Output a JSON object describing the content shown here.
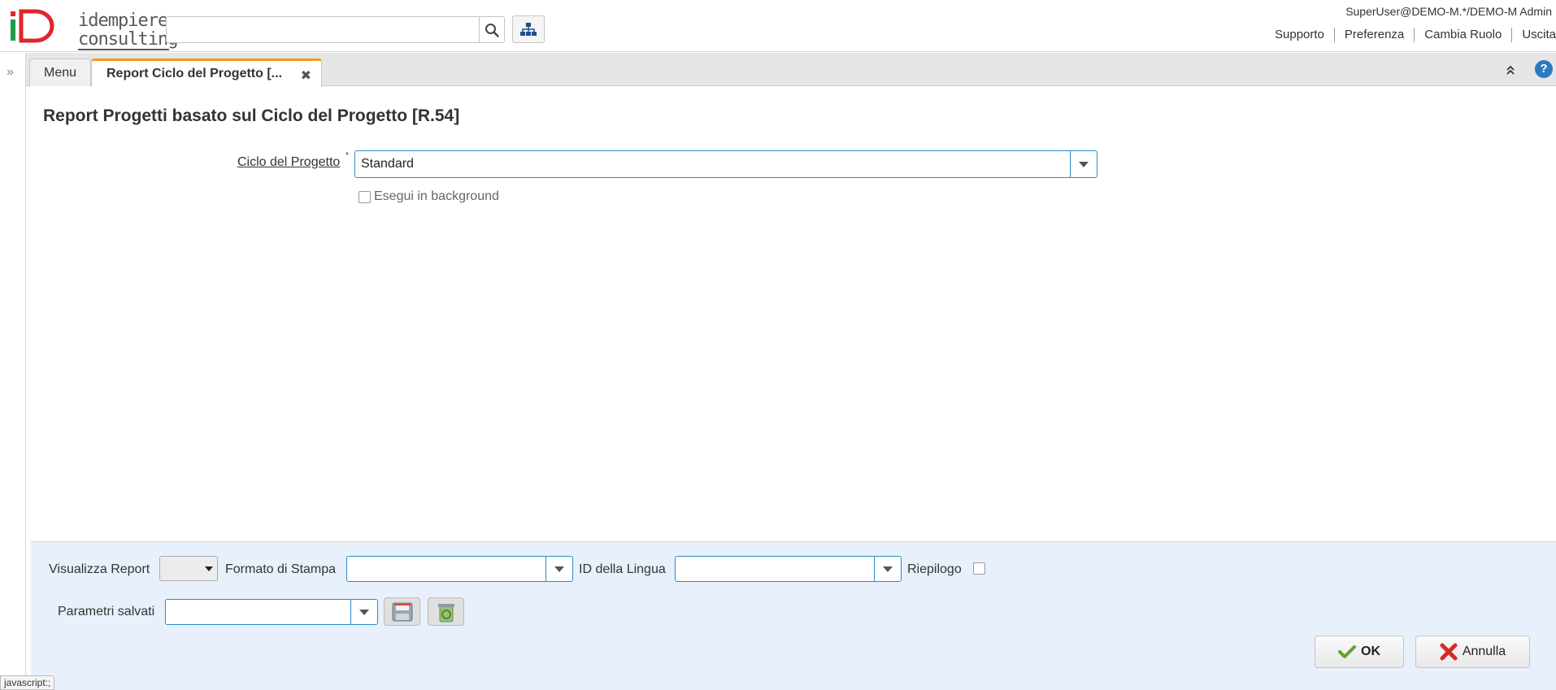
{
  "header": {
    "logo_line1": "idempiere",
    "logo_line2": "consulting",
    "search_placeholder": "",
    "user": "SuperUser@DEMO-M.*/DEMO-M Admin",
    "links": [
      "Supporto",
      "Preferenza",
      "Cambia Ruolo",
      "Uscita"
    ]
  },
  "tabs": [
    {
      "label": "Menu",
      "active": false
    },
    {
      "label": "Report Ciclo del Progetto [...",
      "active": true
    }
  ],
  "process": {
    "title": "Report Progetti basato sul Ciclo del Progetto [R.54]",
    "field_label": "Ciclo del Progetto",
    "field_value": "Standard",
    "background_label": "Esegui in background",
    "background_checked": false
  },
  "bottom": {
    "view_report_label": "Visualizza Report",
    "print_format_label": "Formato di Stampa",
    "print_format_value": "",
    "language_label": "ID della Lingua",
    "language_value": "",
    "summary_label": "Riepilogo",
    "summary_checked": false,
    "saved_params_label": "Parametri salvati",
    "saved_params_value": "",
    "ok_label": "OK",
    "cancel_label": "Annulla"
  },
  "status_hint": "javascript:;",
  "colors": {
    "accent": "#2c8bc8",
    "tab_active": "#f39a1f",
    "panel_bg": "#e8f0fb",
    "help": "#2c79c0"
  }
}
